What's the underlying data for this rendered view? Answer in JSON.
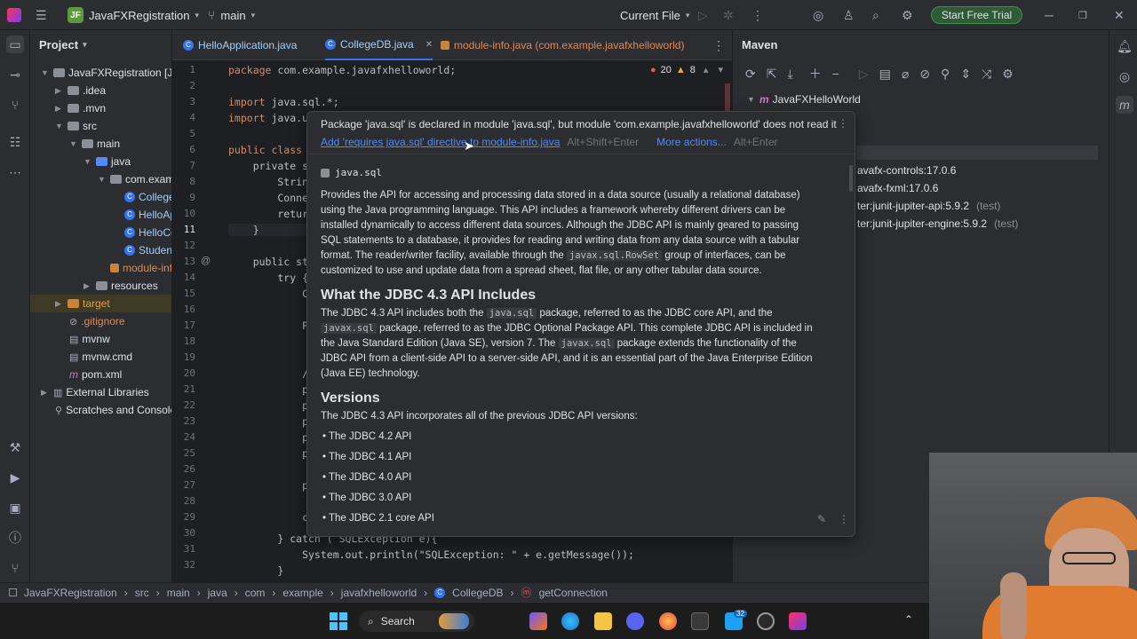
{
  "titlebar": {
    "project_badge": "JF",
    "project_name": "JavaFXRegistration",
    "branch": "main",
    "run_config": "Current File",
    "trial_button": "Start Free Trial"
  },
  "project_panel": {
    "title": "Project",
    "items": [
      {
        "label": "JavaFXRegistration [Ja",
        "kind": "module"
      },
      {
        "label": ".idea",
        "kind": "folder"
      },
      {
        "label": ".mvn",
        "kind": "folder"
      },
      {
        "label": "src",
        "kind": "folder"
      },
      {
        "label": "main",
        "kind": "folder"
      },
      {
        "label": "java",
        "kind": "source-folder"
      },
      {
        "label": "com.examp",
        "kind": "package"
      },
      {
        "label": "College",
        "kind": "class"
      },
      {
        "label": "HelloAp",
        "kind": "class"
      },
      {
        "label": "HelloCo",
        "kind": "class"
      },
      {
        "label": "Student",
        "kind": "class"
      },
      {
        "label": "module-inf",
        "kind": "file"
      },
      {
        "label": "resources",
        "kind": "folder"
      },
      {
        "label": "target",
        "kind": "excluded-folder"
      },
      {
        "label": ".gitignore",
        "kind": "file"
      },
      {
        "label": "mvnw",
        "kind": "file"
      },
      {
        "label": "mvnw.cmd",
        "kind": "file"
      },
      {
        "label": "pom.xml",
        "kind": "maven-file"
      },
      {
        "label": "External Libraries",
        "kind": "library"
      },
      {
        "label": "Scratches and Console",
        "kind": "scratch"
      }
    ]
  },
  "editor": {
    "tabs": [
      {
        "label": "HelloApplication.java"
      },
      {
        "label": "CollegeDB.java",
        "active": true
      },
      {
        "label": "module-info.java (com.example.javafxhelloworld)"
      }
    ],
    "errors": "20",
    "warnings": "8",
    "line_numbers": [
      "1",
      "2",
      "3",
      "4",
      "5",
      "6",
      "7",
      "8",
      "9",
      "10",
      "11",
      "12",
      "13",
      "14",
      "15",
      "16",
      "17",
      "18",
      "19",
      "20",
      "21",
      "22",
      "23",
      "24",
      "25",
      "26",
      "27",
      "28",
      "29",
      "30",
      "31",
      "32"
    ],
    "code": {
      "l1_kw": "package",
      "l1": " com.example.javafxhelloworld;",
      "l3_kw": "import",
      "l3": " java.sql.*;",
      "l4_kw": "import",
      "l4": " java.u",
      "l6_kw": "public class",
      "l7": "    private s",
      "l8": "        Strin",
      "l9": "        Conne",
      "l10": "        retur",
      "l11": "    }",
      "l13": "    public st",
      "l14": "        try {",
      "l15": "            C",
      "l17": "            P",
      "l20": "            /",
      "l21": "            p",
      "l22": "            p",
      "l23": "            p",
      "l24": "            p",
      "l25": "            p",
      "l27": "            p",
      "l29": "            c",
      "l30": "        } catch ( SQLException e){",
      "l31": "            System.out.println(\"SQLException: \" + e.getMessage());",
      "l32": "        }"
    }
  },
  "maven": {
    "title": "Maven",
    "root": "JavaFXHelloWorld",
    "deps": [
      "avafx-controls:17.0.6",
      "avafx-fxml:17.0.6",
      "ter:junit-jupiter-api:5.9.2",
      "ter:junit-jupiter-engine:5.9.2"
    ],
    "test_tag": "(test)"
  },
  "popup": {
    "message": "Package 'java.sql' is declared in module 'java.sql', but module 'com.example.javafxhelloworld' does not read it",
    "fix_link": "Add 'requires java.sql' directive to module-info.java",
    "fix_shortcut": "Alt+Shift+Enter",
    "more_actions": "More actions...",
    "more_shortcut": "Alt+Enter",
    "module_name": "java.sql",
    "intro_1": "Provides the API for accessing and processing data stored in a data source (usually a relational database) using the Java programming language. This API includes a framework whereby different drivers can be installed dynamically to access different data sources. Although the JDBC API is mainly geared to passing SQL statements to a database, it provides for reading and writing data from any data source with a tabular format. The reader/writer facility, available through the ",
    "intro_code": "javax.sql.RowSet",
    "intro_2": " group of interfaces, can be customized to use and update data from a spread sheet, flat file, or any other tabular data source.",
    "h_includes": "What the JDBC 4.3 API Includes",
    "inc_1": "The JDBC 4.3 API includes both the ",
    "inc_code1": "java.sql",
    "inc_2": " package, referred to as the JDBC core API, and the ",
    "inc_code2": "javax.sql",
    "inc_3": " package, referred to as the JDBC Optional Package API. This complete JDBC API is included in the Java Standard Edition (Java SE), version 7. The ",
    "inc_code3": "javax.sql",
    "inc_4": " package extends the functionality of the JDBC API from a client-side API to a server-side API, and it is an essential part of the Java Enterprise Edition (Java EE) technology.",
    "h_versions": "Versions",
    "versions_intro": "The JDBC 4.3 API incorporates all of the previous JDBC API versions:",
    "versions": [
      "The JDBC 4.2 API",
      "The JDBC 4.1 API",
      "The JDBC 4.0 API",
      "The JDBC 3.0 API",
      "The JDBC 2.1 core API"
    ]
  },
  "statusbar": {
    "crumbs": [
      "JavaFXRegistration",
      "src",
      "main",
      "java",
      "com",
      "example",
      "javafxhelloworld",
      "CollegeDB",
      "getConnection"
    ]
  },
  "taskbar": {
    "search": "Search",
    "badge": "32"
  }
}
